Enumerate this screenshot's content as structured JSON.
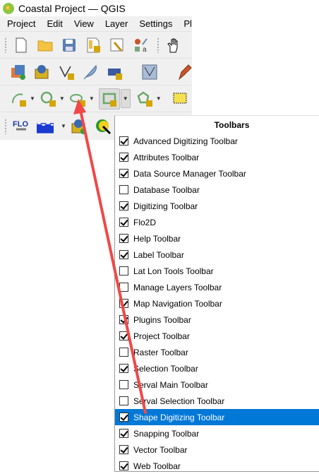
{
  "window": {
    "title": "Coastal Project — QGIS"
  },
  "menubar": [
    "Project",
    "Edit",
    "View",
    "Layer",
    "Settings",
    "Plugins"
  ],
  "context_menu": {
    "title": "Toolbars",
    "items": [
      {
        "label": "Advanced Digitizing Toolbar",
        "checked": true
      },
      {
        "label": "Attributes Toolbar",
        "checked": true
      },
      {
        "label": "Data Source Manager Toolbar",
        "checked": true
      },
      {
        "label": "Database Toolbar",
        "checked": false
      },
      {
        "label": "Digitizing Toolbar",
        "checked": true
      },
      {
        "label": "Flo2D",
        "checked": true
      },
      {
        "label": "Help Toolbar",
        "checked": true
      },
      {
        "label": "Label Toolbar",
        "checked": true
      },
      {
        "label": "Lat Lon Tools Toolbar",
        "checked": false
      },
      {
        "label": "Manage Layers Toolbar",
        "checked": false
      },
      {
        "label": "Map Navigation Toolbar",
        "checked": true
      },
      {
        "label": "Plugins Toolbar",
        "checked": true
      },
      {
        "label": "Project Toolbar",
        "checked": true
      },
      {
        "label": "Raster Toolbar",
        "checked": false
      },
      {
        "label": "Selection Toolbar",
        "checked": true
      },
      {
        "label": "Serval Main Toolbar",
        "checked": false
      },
      {
        "label": "Serval Selection Toolbar",
        "checked": false
      },
      {
        "label": "Shape Digitizing Toolbar",
        "checked": true,
        "highlighted": true
      },
      {
        "label": "Snapping Toolbar",
        "checked": true
      },
      {
        "label": "Vector Toolbar",
        "checked": true
      },
      {
        "label": "Web Toolbar",
        "checked": true
      }
    ]
  },
  "colors": {
    "highlight": "#0078d7",
    "annotation_arrow": "#f04848"
  }
}
